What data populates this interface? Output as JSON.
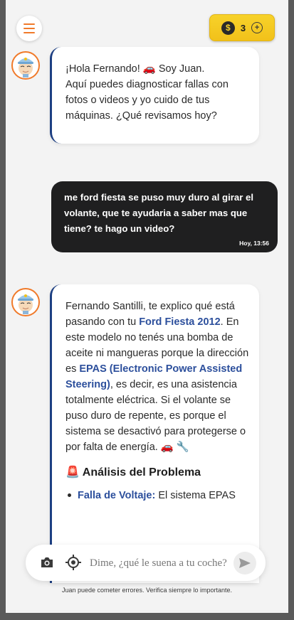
{
  "header": {
    "menu_icon": "hamburger-icon",
    "coins": {
      "symbol": "$",
      "count": "3",
      "add_icon": "plus-circle-icon"
    }
  },
  "messages": [
    {
      "role": "assistant",
      "greeting": "¡Hola Fernando! 🚗 Soy Juan.",
      "text": "Aquí puedes diagnosticar fallas con fotos o videos y yo cuido de tus máquinas. ¿Qué revisamos hoy?"
    },
    {
      "role": "user",
      "text": "me ford fiesta se puso muy duro al girar el volante, que te ayudaria a saber mas que tiene? te hago un video?",
      "time": "Hoy, 13:56"
    },
    {
      "role": "assistant",
      "intro": "Fernando Santilli, te explico qué está pasando con tu ",
      "car": "Ford Fiesta 2012",
      "mid": ". En este modelo no tenés una bomba de aceite ni mangueras porque la dirección es ",
      "system": "EPAS (Electronic Power Assisted Steering)",
      "rest": ", es decir, es una asistencia totalmente eléctrica. Si el volante se puso duro de repente, es porque el sistema se desactivó para protegerse o por falta de energía. 🚗 🔧",
      "section_icon": "🚨",
      "section_title": "Análisis del Problema",
      "bullet_label": "Falla de Voltaje:",
      "bullet_text": " El sistema EPAS"
    }
  ],
  "composer": {
    "placeholder": "Dime, ¿qué le suena a tu coche?",
    "camera_icon": "camera-icon",
    "target_icon": "crosshair-icon",
    "send_icon": "send-icon"
  },
  "disclaimer": "Juan puede cometer errores. Verifica siempre lo importante.",
  "colors": {
    "accent": "#f07a2a",
    "link": "#2c4f9c",
    "coin": "#f2c11a",
    "user_bubble": "#1f1f20"
  }
}
